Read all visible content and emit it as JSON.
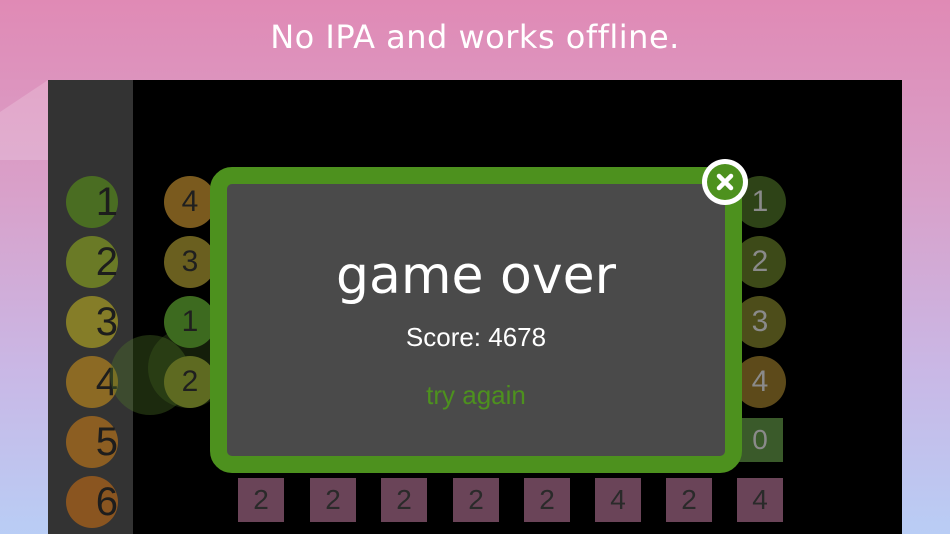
{
  "tagline": "No IPA and works offline.",
  "board": {
    "left_column": [
      "1",
      "2",
      "3",
      "4",
      "5",
      "6"
    ],
    "left_column_colors": [
      "#4a6d22",
      "#6a7a26",
      "#857d28",
      "#8c6a24",
      "#8c5e22",
      "#8a5520"
    ],
    "middle_column": [
      "4",
      "3",
      "1",
      "2"
    ],
    "middle_column_colors": [
      "#7a5a1e",
      "#6a5f1f",
      "#3d6a1f",
      "#5e6a21"
    ],
    "right_column": [
      "1",
      "2",
      "3",
      "4"
    ],
    "right_column_colors": [
      "#2e4317",
      "#3d4a18",
      "#4d4d1a",
      "#5d4a1a"
    ],
    "right_box": "0",
    "right_box_color": "#3a5a2a",
    "bottom_row": [
      "2",
      "2",
      "2",
      "2",
      "2",
      "4",
      "2",
      "4"
    ],
    "bottom_row_color": "#6a4458"
  },
  "dialog": {
    "title": "game over",
    "score": "Score: 4678",
    "try_again": "try again",
    "accent_color": "#4d911e"
  }
}
